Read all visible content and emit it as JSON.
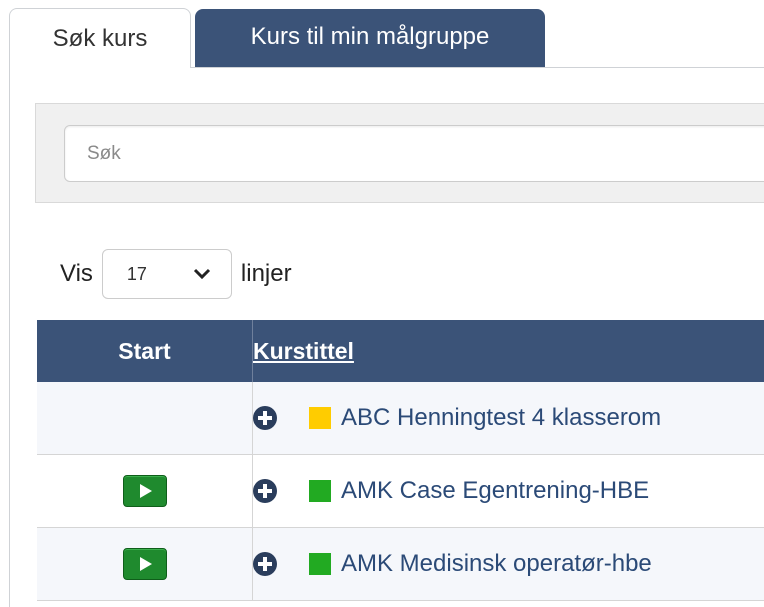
{
  "tabs": [
    {
      "label": "Søk kurs",
      "active": true
    },
    {
      "label": "Kurs til min målgruppe",
      "active": false
    }
  ],
  "search": {
    "placeholder": "Søk",
    "value": ""
  },
  "length_menu": {
    "prefix": "Vis",
    "value": "17",
    "suffix": "linjer"
  },
  "table": {
    "headers": {
      "start": "Start",
      "title": "Kurstittel"
    },
    "rows": [
      {
        "has_start": false,
        "status_color": "#ffcc00",
        "title": "ABC Henningtest 4 klasserom"
      },
      {
        "has_start": true,
        "status_color": "#22aa22",
        "title": "AMK Case Egentrening-HBE"
      },
      {
        "has_start": true,
        "status_color": "#22aa22",
        "title": "AMK Medisinsk operatør-hbe"
      }
    ]
  },
  "colors": {
    "header": "#3b5378",
    "link": "#2b4a77",
    "start_button": "#1f8a2e"
  },
  "icons": {
    "expand": "plus-circle-icon",
    "start": "play-icon",
    "select": "chevron-down-icon"
  }
}
